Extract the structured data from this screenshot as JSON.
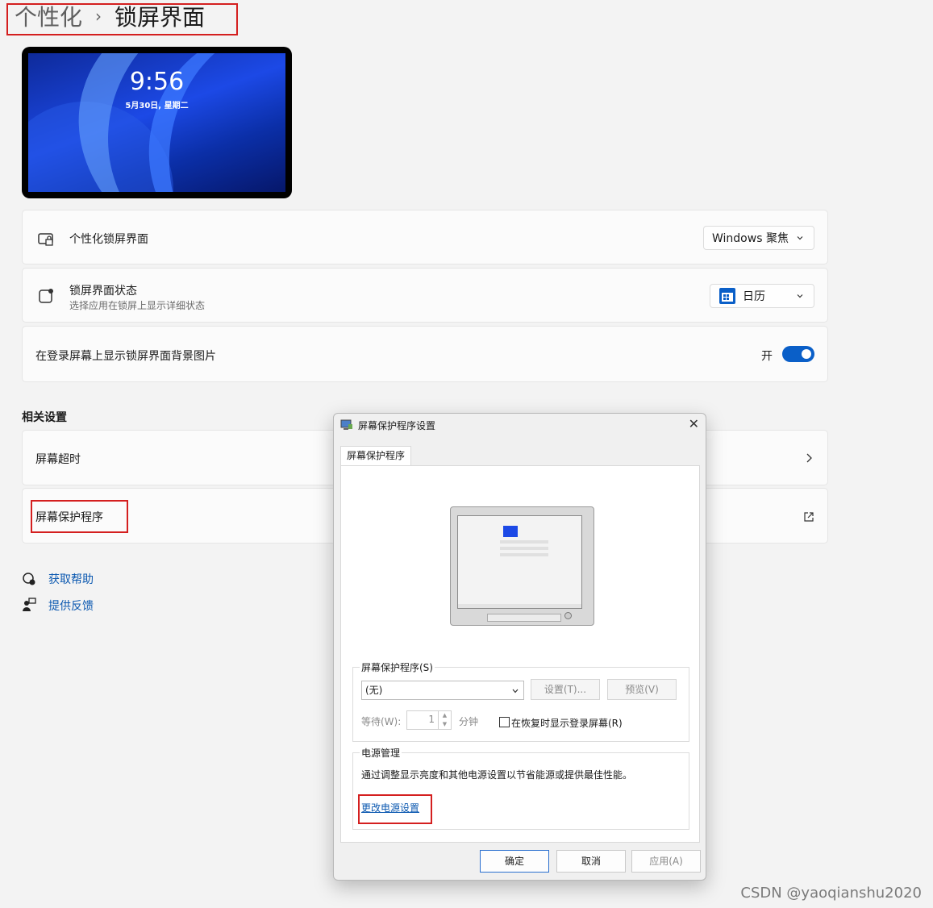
{
  "breadcrumb": {
    "parent": "个性化",
    "separator": "›",
    "current": "锁屏界面"
  },
  "preview": {
    "time": "9:56",
    "date": "5月30日, 星期二"
  },
  "settings": {
    "personalize_lock": {
      "label": "个性化锁屏界面",
      "value": "Windows 聚焦"
    },
    "lock_status": {
      "label": "锁屏界面状态",
      "description": "选择应用在锁屏上显示详细状态",
      "value": "日历"
    },
    "show_bg": {
      "label": "在登录屏幕上显示锁屏界面背景图片",
      "state_label": "开",
      "on": true
    }
  },
  "related": {
    "title": "相关设置",
    "items": [
      {
        "label": "屏幕超时"
      },
      {
        "label": "屏幕保护程序"
      }
    ]
  },
  "help_links": {
    "get_help": "获取帮助",
    "feedback": "提供反馈"
  },
  "dialog": {
    "title": "屏幕保护程序设置",
    "tab": "屏幕保护程序",
    "screensaver_group": "屏幕保护程序(S)",
    "screensaver_value": "(无)",
    "settings_btn": "设置(T)...",
    "preview_btn": "预览(V)",
    "wait_label": "等待(W):",
    "wait_value": "1",
    "wait_unit": "分钟",
    "resume_label": "在恢复时显示登录屏幕(R)",
    "power_group": "电源管理",
    "power_desc": "通过调整显示亮度和其他电源设置以节省能源或提供最佳性能。",
    "power_link": "更改电源设置",
    "ok": "确定",
    "cancel": "取消",
    "apply": "应用(A)"
  },
  "watermark": "CSDN @yaoqianshu2020",
  "colors": {
    "accent": "#0a5fc8",
    "highlight_box": "#d41f1f",
    "link": "#0b58b0"
  }
}
